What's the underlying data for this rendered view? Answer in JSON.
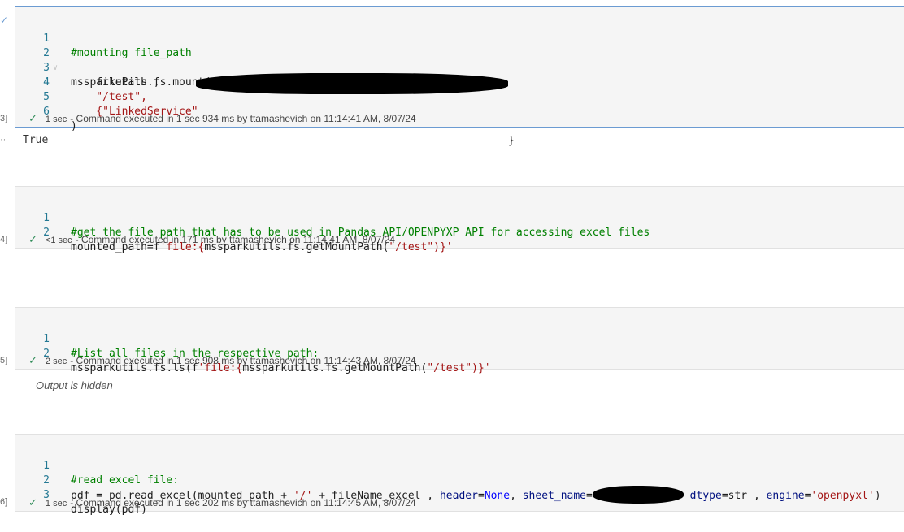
{
  "cells": [
    {
      "exec_label": "3]",
      "lines": [
        {
          "n": "1",
          "code": "#mounting file_path"
        },
        {
          "n": "2",
          "code": "mssparkutils.fs.mount("
        },
        {
          "n": "3",
          "code": "    filePath ,"
        },
        {
          "n": "4",
          "code": "    \"/test\","
        },
        {
          "n": "5",
          "code": "    {\"LinkedService\"",
          "tail": "}"
        },
        {
          "n": "6",
          "code": ")"
        }
      ],
      "status": {
        "duration": "1 sec",
        "text": "- Command executed in 1 sec 934 ms by ttamashevich on 11:14:41 AM, 8/07/24"
      },
      "output": "True"
    },
    {
      "exec_label": "4]",
      "lines": [
        {
          "n": "1",
          "code": "#get the file path that has to be used in Pandas API/OPENPYXP API for accessing excel files"
        },
        {
          "n": "2",
          "code_pre": "mounted_path=f",
          "code_str": "'file:{",
          "code_mid": "mssparkutils.fs.getMountPath(",
          "code_str2": "\"/test\"",
          "code_end": ")}'"
        }
      ],
      "status": {
        "duration": "<1 sec",
        "text": "- Command executed in 171 ms by ttamashevich on 11:14:41 AM, 8/07/24"
      }
    },
    {
      "exec_label": "5]",
      "lines": [
        {
          "n": "1",
          "code": "#List all files in the respective path:"
        },
        {
          "n": "2",
          "code_pre": "mssparkutils.fs.ls(f",
          "code_str": "'file:{",
          "code_mid": "mssparkutils.fs.getMountPath(",
          "code_str2": "\"/test\"",
          "code_end": ")}'"
        }
      ],
      "status": {
        "duration": "2 sec",
        "text": "- Command executed in 1 sec 908 ms by ttamashevich on 11:14:43 AM, 8/07/24"
      },
      "output_hidden": "Output is hidden"
    },
    {
      "exec_label": "6]",
      "lines": [
        {
          "n": "1",
          "code": "#read excel file:"
        },
        {
          "n": "2",
          "code_a": "pdf = pd.read_excel(mounted_path + ",
          "code_b": "'/'",
          "code_c": " + fileName_excel , ",
          "code_d": "header",
          "code_e": "=",
          "code_f": "None",
          "code_g": ", ",
          "code_h": "sheet_name",
          "code_i": "=",
          "code_j": " dtype",
          "code_k": "=str , ",
          "code_l": "engine",
          "code_m": "=",
          "code_n": "'openpyxl'",
          "code_o": ")"
        },
        {
          "n": "3",
          "code": "display(pdf)"
        }
      ],
      "status": {
        "duration": "1 sec",
        "text": "- Command executed in 1 sec 202 ms by ttamashevich on 11:14:45 AM, 8/07/24"
      }
    }
  ]
}
